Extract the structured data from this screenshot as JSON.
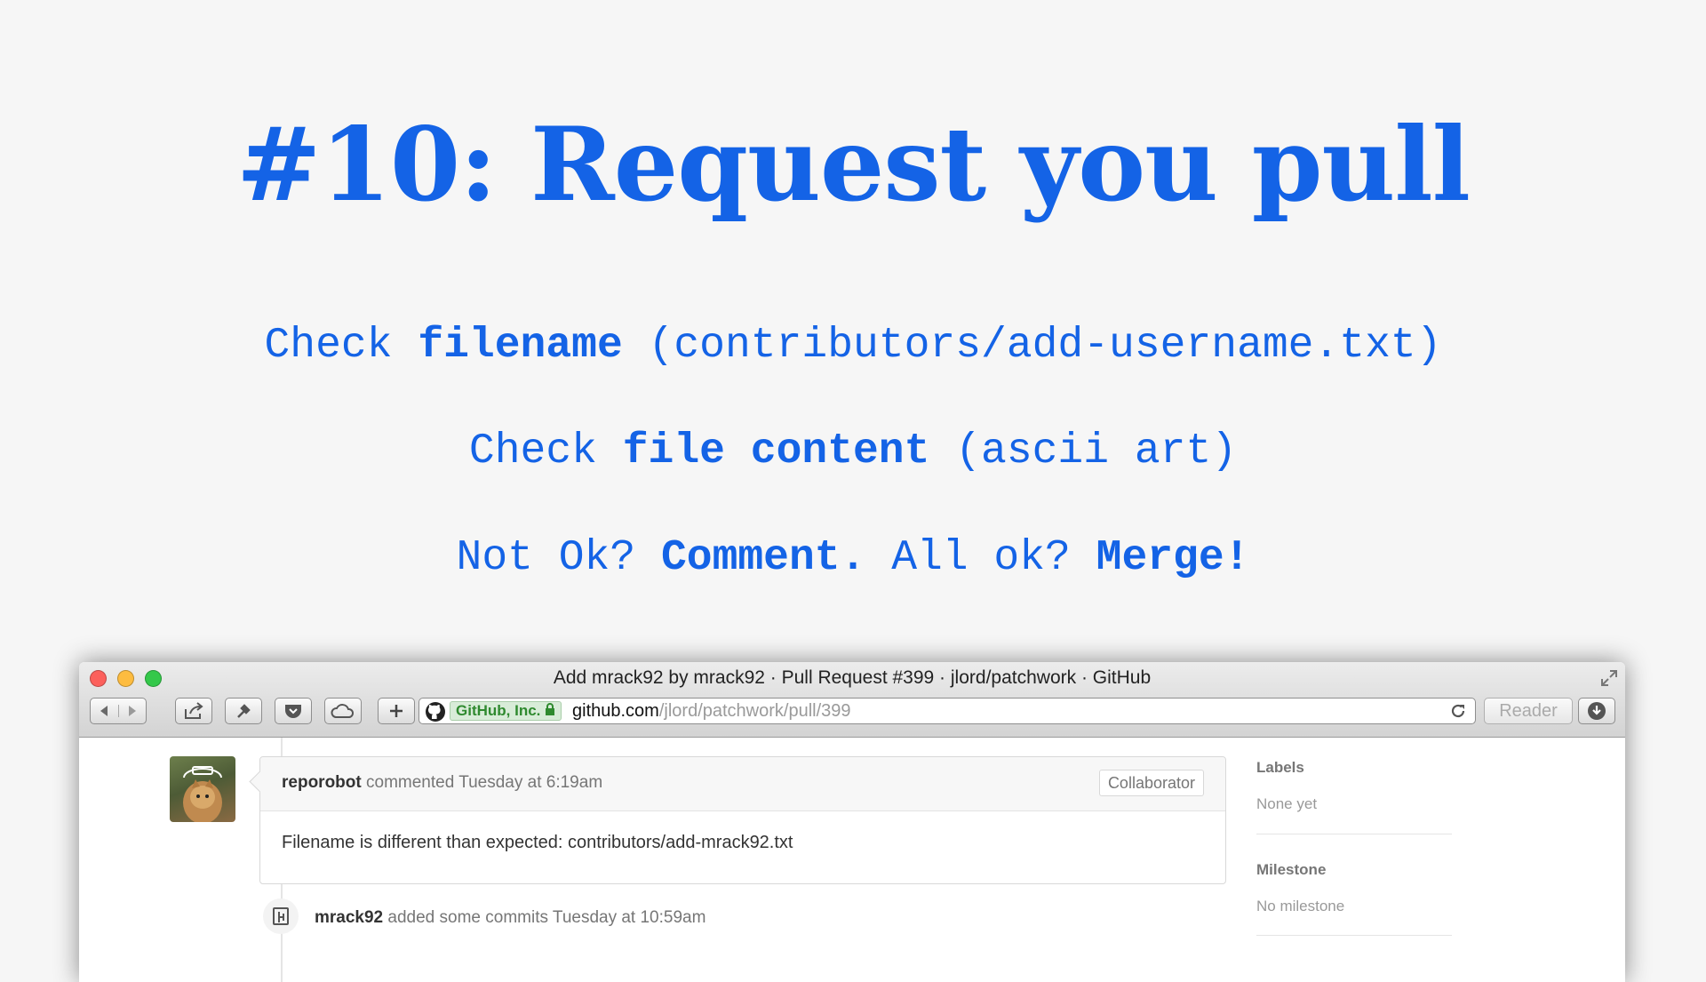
{
  "slide": {
    "title": "#10:  Request you pull",
    "line1": {
      "pre": "Check ",
      "bold": "filename",
      "post": " (contributors/add-username.txt)"
    },
    "line2": {
      "pre": "Check ",
      "bold": "file content",
      "post": " (ascii art)"
    },
    "line3": {
      "pre": "Not Ok? ",
      "bold1": "Comment.",
      "mid": " All ok? ",
      "bold2": "Merge!"
    }
  },
  "browser": {
    "window_title": "Add mrack92 by mrack92 · Pull Request #399 · jlord/patchwork · GitHub",
    "cert_label": "GitHub, Inc.",
    "url_host": "github.com",
    "url_path": "/jlord/patchwork/pull/399",
    "reader_label": "Reader"
  },
  "comment": {
    "author": "reporobot",
    "action": " commented Tuesday at 6:19am",
    "badge": "Collaborator",
    "body": "Filename is different than expected: contributors/add-mrack92.txt"
  },
  "event": {
    "author": "mrack92",
    "text": " added some commits Tuesday at 10:59am"
  },
  "sidebar": {
    "labels_title": "Labels",
    "labels_value": "None yet",
    "milestone_title": "Milestone",
    "milestone_value": "No milestone"
  },
  "colors": {
    "slide_text": "#1463e6",
    "cert_green": "#2f8a2f"
  }
}
